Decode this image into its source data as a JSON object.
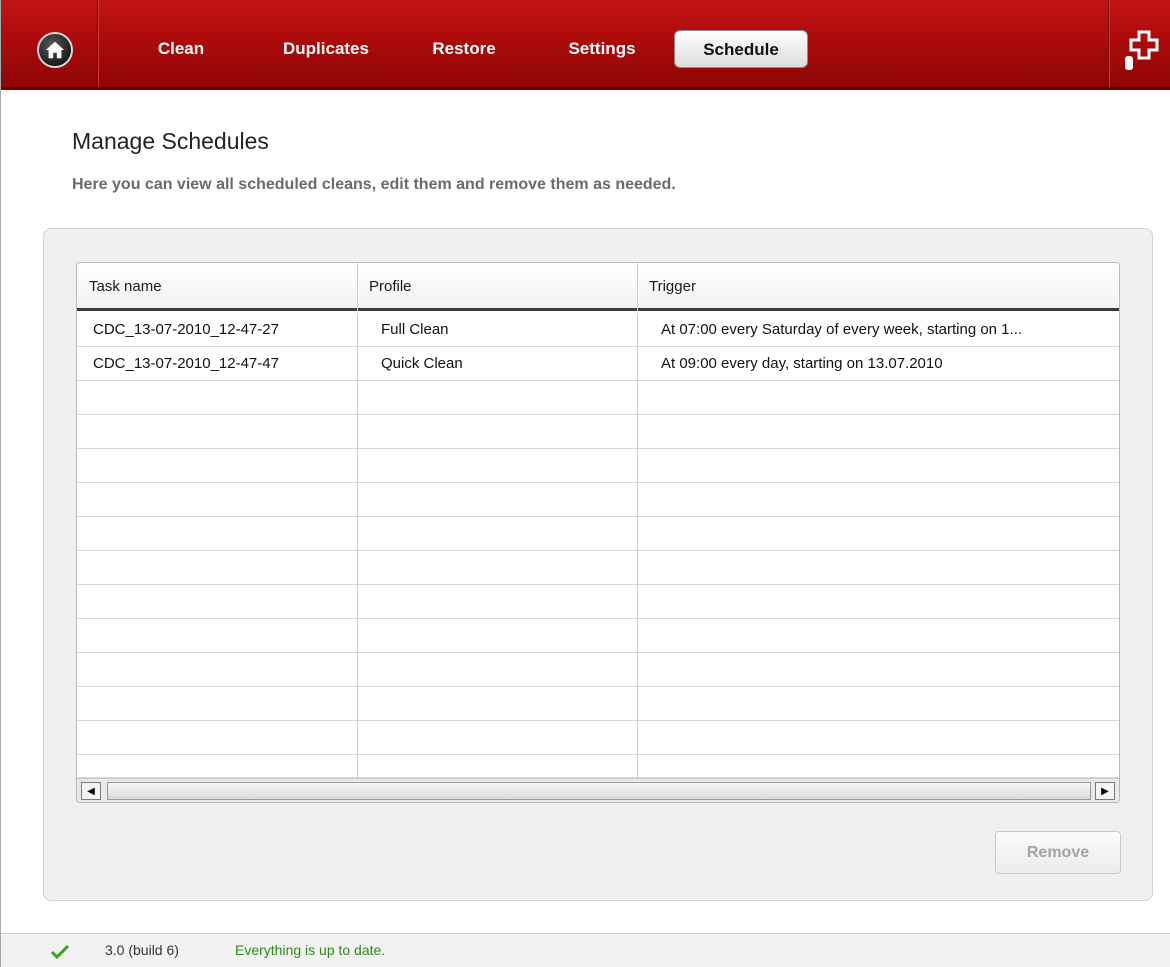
{
  "nav": {
    "items": [
      {
        "label": "Clean"
      },
      {
        "label": "Duplicates"
      },
      {
        "label": "Restore"
      },
      {
        "label": "Settings"
      },
      {
        "label": "Schedule",
        "active": true
      }
    ],
    "home_icon": "home-icon",
    "logo_icon": "puzzle-logo-icon"
  },
  "page": {
    "title": "Manage Schedules",
    "subtitle": "Here you can view all scheduled cleans, edit them and remove them as needed."
  },
  "table": {
    "columns": [
      "Task name",
      "Profile",
      "Trigger"
    ],
    "rows": [
      {
        "task": "CDC_13-07-2010_12-47-27",
        "profile": "Full Clean",
        "trigger": "At 07:00 every Saturday of every week, starting on 1..."
      },
      {
        "task": "CDC_13-07-2010_12-47-47",
        "profile": "Quick Clean",
        "trigger": "At 09:00 every day, starting on 13.07.2010"
      }
    ]
  },
  "actions": {
    "remove_label": "Remove"
  },
  "status": {
    "version": "3.0 (build 6)",
    "message": "Everything is up to date."
  },
  "colors": {
    "header_red": "#ad0b0b",
    "status_green": "#2d8a16"
  }
}
